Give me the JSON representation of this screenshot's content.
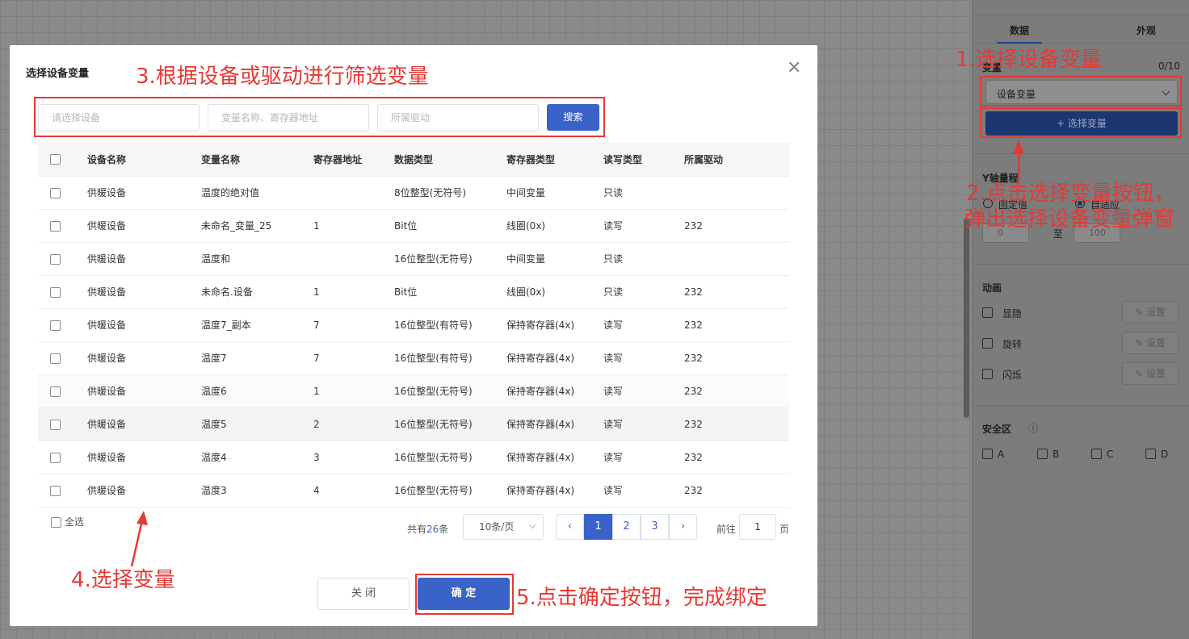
{
  "right_panel": {
    "tabs": [
      "数据",
      "外观"
    ],
    "variable_label": "变量",
    "variable_count": "0/10",
    "select_value": "设备变量",
    "choose_button": "+ 选择变量",
    "y_axis_label": "Y轴量程",
    "fixed_label": "固定值",
    "adaptive_label": "自适应",
    "range_from": "0",
    "range_to_label": "至",
    "range_to": "100",
    "animation_title": "动画",
    "animation_items": [
      "显隐",
      "旋转",
      "闪烁"
    ],
    "setting_label": "设置",
    "safe_zone_title": "安全区",
    "safe_zone_items": [
      "A",
      "B",
      "C",
      "D"
    ]
  },
  "modal": {
    "title": "选择设备变量",
    "filters": {
      "device_placeholder": "请选择设备",
      "variable_placeholder": "变量名称、寄存器地址",
      "driver_placeholder": "所属驱动"
    },
    "search_label": "搜索",
    "columns": [
      "设备名称",
      "变量名称",
      "寄存器地址",
      "数据类型",
      "寄存器类型",
      "读写类型",
      "所属驱动"
    ],
    "rows": [
      [
        "供暖设备",
        "温度的绝对值",
        "",
        "8位整型(无符号)",
        "中间变量",
        "只读",
        ""
      ],
      [
        "供暖设备",
        "未命名_变量_25",
        "1",
        "Bit位",
        "线圈(0x)",
        "读写",
        "232"
      ],
      [
        "供暖设备",
        "温度和",
        "",
        "16位整型(无符号)",
        "中间变量",
        "只读",
        ""
      ],
      [
        "供暖设备",
        "未命名.设备",
        "1",
        "Bit位",
        "线圈(0x)",
        "只读",
        "232"
      ],
      [
        "供暖设备",
        "温度7_副本",
        "7",
        "16位整型(有符号)",
        "保持寄存器(4x)",
        "读写",
        "232"
      ],
      [
        "供暖设备",
        "温度7",
        "7",
        "16位整型(有符号)",
        "保持寄存器(4x)",
        "读写",
        "232"
      ],
      [
        "供暖设备",
        "温度6",
        "1",
        "16位整型(无符号)",
        "保持寄存器(4x)",
        "读写",
        "232"
      ],
      [
        "供暖设备",
        "温度5",
        "2",
        "16位整型(无符号)",
        "保持寄存器(4x)",
        "读写",
        "232"
      ],
      [
        "供暖设备",
        "温度4",
        "3",
        "16位整型(无符号)",
        "保持寄存器(4x)",
        "读写",
        "232"
      ],
      [
        "供暖设备",
        "温度3",
        "4",
        "16位整型(无符号)",
        "保持寄存器(4x)",
        "读写",
        "232"
      ]
    ],
    "select_all": "全选",
    "pagination": {
      "total_prefix": "共有",
      "total": "26",
      "total_suffix": "条",
      "page_size": "10条/页",
      "pages": [
        "1",
        "2",
        "3"
      ],
      "current": "1",
      "goto_prefix": "前往",
      "goto_value": "1",
      "goto_suffix": "页"
    },
    "close_label": "关 闭",
    "ok_label": "确 定"
  },
  "annotations": {
    "step1": "1.选择设备变量",
    "step2_line1": "2.点击选择变量按钮，",
    "step2_line2": "弹出选择设备变量弹窗",
    "step3": "3.根据设备或驱动进行筛选变量",
    "step4": "4.选择变量",
    "step5": "5.点击确定按钮，完成绑定"
  },
  "colors": {
    "primary": "#3a63c9",
    "annotation_red": "#e53935"
  }
}
